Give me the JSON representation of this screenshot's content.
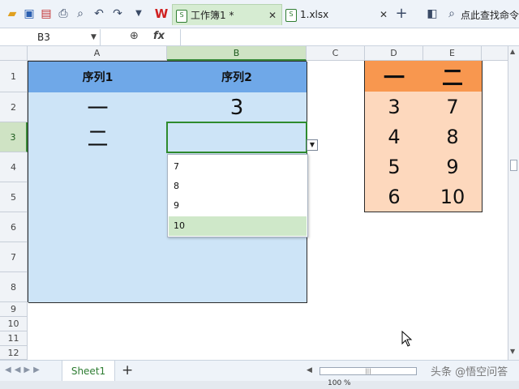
{
  "toolbar": {
    "tabs": [
      {
        "label": "工作簿1 *",
        "icon": "spreadsheet-file-icon"
      },
      {
        "label": "1.xlsx",
        "icon": "spreadsheet-file-icon"
      }
    ],
    "search_label": "点此查找命令",
    "accent": "#2e7d32"
  },
  "formula_bar": {
    "cell_ref": "B3",
    "fx_label": "fx"
  },
  "grid": {
    "columns": [
      "A",
      "B",
      "C",
      "D",
      "E"
    ],
    "rows": [
      "1",
      "2",
      "3",
      "4",
      "5",
      "6",
      "7",
      "8",
      "9",
      "10",
      "11",
      "12"
    ],
    "selected_cell": "B3",
    "table1": {
      "headers": [
        "序列1",
        "序列2"
      ],
      "rows": [
        [
          "一",
          "3"
        ],
        [
          "二",
          ""
        ],
        [
          "",
          ""
        ],
        [
          "",
          ""
        ],
        [
          "",
          ""
        ],
        [
          "",
          ""
        ],
        [
          "",
          ""
        ]
      ],
      "header_color": "#6fa8e8",
      "body_color": "#cde4f7"
    },
    "table2": {
      "headers": [
        "一",
        "二"
      ],
      "rows": [
        [
          "3",
          "7"
        ],
        [
          "4",
          "8"
        ],
        [
          "5",
          "9"
        ],
        [
          "6",
          "10"
        ]
      ],
      "header_color": "#f8974f",
      "body_color": "#fdd8bd"
    }
  },
  "dropdown": {
    "options": [
      "7",
      "8",
      "9",
      "10"
    ],
    "highlighted": "10"
  },
  "sheets": {
    "tabs": [
      "Sheet1"
    ],
    "add_label": "+"
  },
  "watermark": "头条 @悟空问答",
  "status": {
    "zoom": "100 %"
  }
}
